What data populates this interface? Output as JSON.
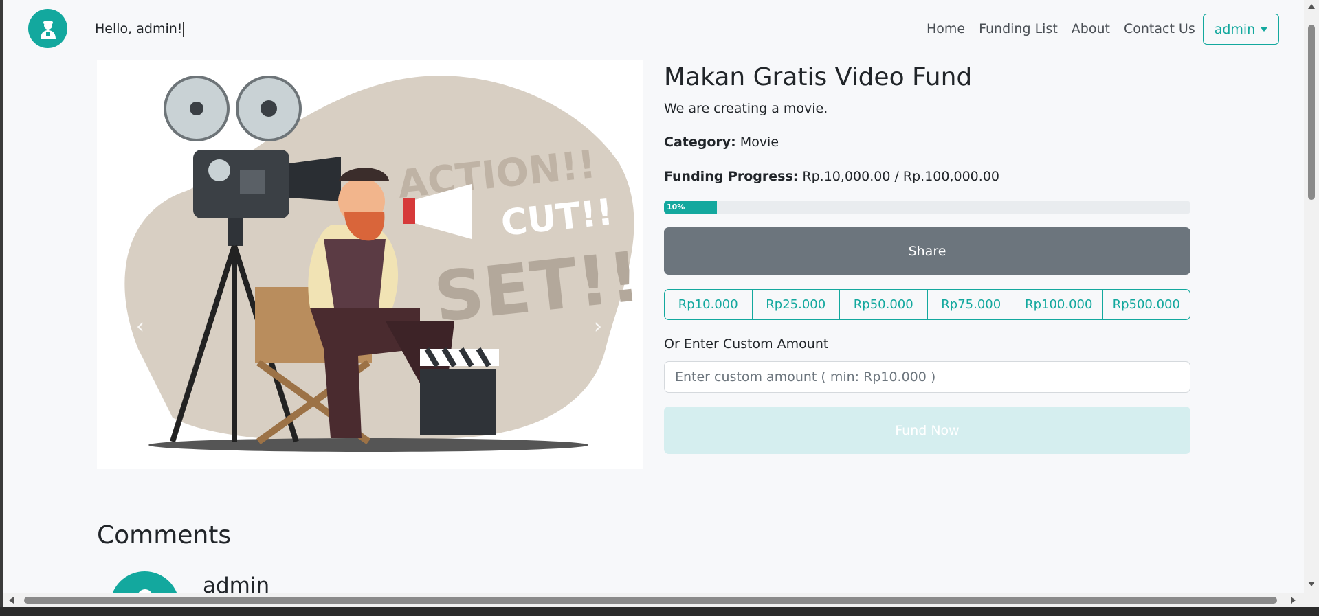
{
  "navbar": {
    "greeting": "Hello, admin!",
    "links": [
      "Home",
      "Funding List",
      "About",
      "Contact Us"
    ],
    "user_button": "admin"
  },
  "carousel": {
    "prev_icon": "chevron-left-icon",
    "next_icon": "chevron-right-icon",
    "image_text": [
      "ACTION!!",
      "CUT!!",
      "SET!!"
    ]
  },
  "fund": {
    "title": "Makan Gratis Video Fund",
    "description": "We are creating a movie.",
    "category_label": "Category:",
    "category_value": "Movie",
    "progress_label": "Funding Progress:",
    "progress_value": "Rp.10,000.00 / Rp.100,000.00",
    "progress_percent_text": "10%",
    "progress_percent": 10,
    "share_label": "Share",
    "amounts": [
      "Rp10.000",
      "Rp25.000",
      "Rp50.000",
      "Rp75.000",
      "Rp100.000",
      "Rp500.000"
    ],
    "custom_label": "Or Enter Custom Amount",
    "custom_placeholder": "Enter custom amount ( min: Rp10.000 )",
    "fund_label": "Fund Now"
  },
  "comments": {
    "title": "Comments",
    "items": [
      {
        "user": "admin"
      }
    ]
  },
  "colors": {
    "accent": "#13a89e",
    "share": "#6c757d",
    "fund_disabled": "#d5eeef"
  }
}
